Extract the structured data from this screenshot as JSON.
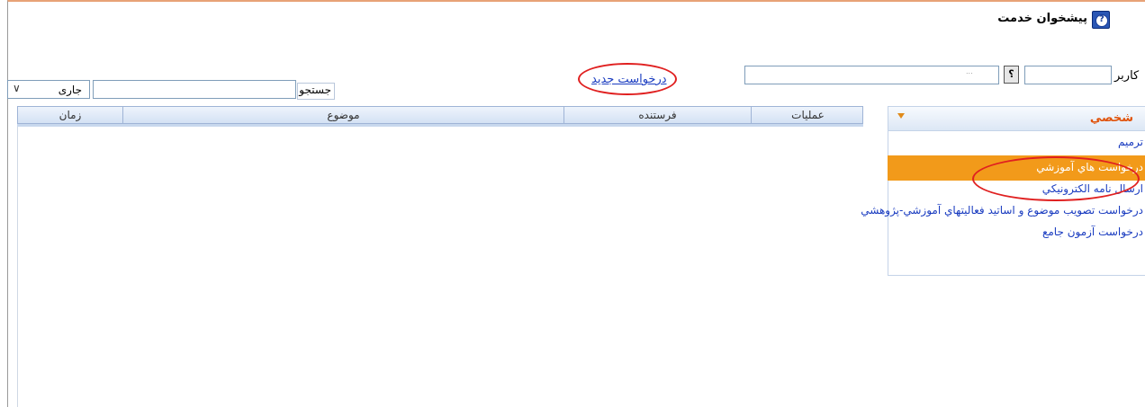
{
  "header": {
    "title": "پیشخوان خدمت"
  },
  "user_row": {
    "label": "کاربر",
    "lookup_button": "؟",
    "display_placeholder": "..."
  },
  "toolbar": {
    "new_request_label": "درخواست جدید"
  },
  "search": {
    "label": "جستجو",
    "status_value": "جاری"
  },
  "table": {
    "columns": [
      "زمان",
      "موضوع",
      "فرستنده",
      "عملیات"
    ]
  },
  "panel": {
    "title": "شخصي",
    "items": [
      "ترميم",
      "درخواست هاي آموزشي",
      "ارسال نامه الكترونيكي",
      "درخواست تصويب موضوع و اساتيد فعاليتهاي آموزشي-پژوهشي",
      "درخواست آزمون جامع"
    ],
    "selected_index": 1
  },
  "colors": {
    "accent": "#f29a1a",
    "link": "#1a3cc0",
    "annotation": "#e02020"
  }
}
